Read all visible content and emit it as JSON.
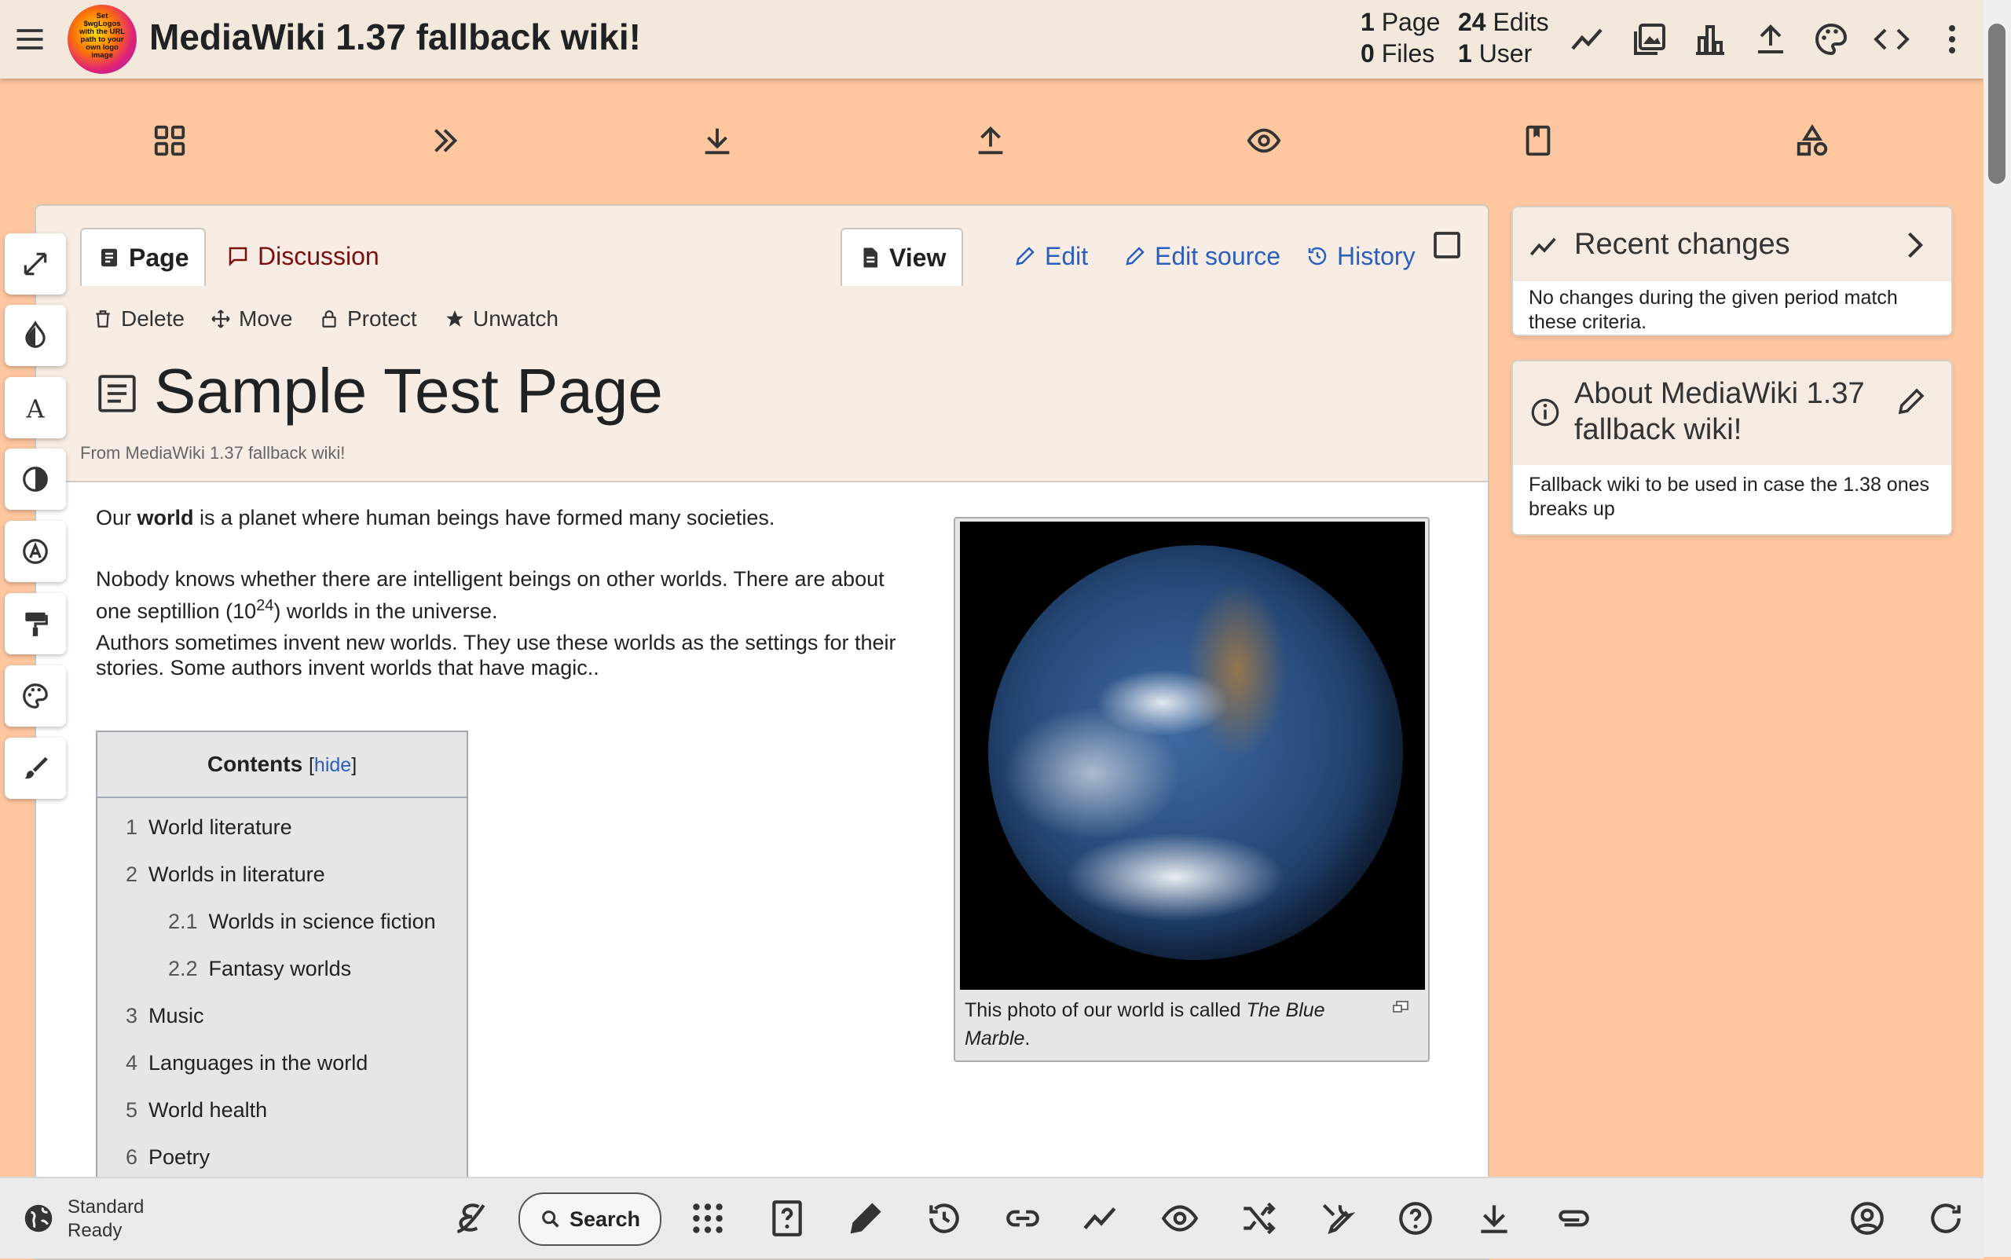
{
  "header": {
    "logo_text": "Set $wgLogos with the URL path to your own logo image",
    "title": "MediaWiki 1.37 fallback wiki!",
    "stats": {
      "pages_count": "1",
      "pages_label": "Page",
      "files_count": "0",
      "files_label": "Files",
      "edits_count": "24",
      "edits_label": "Edits",
      "users_count": "1",
      "users_label": "User"
    },
    "icons": [
      "recent-changes-icon",
      "media-icon",
      "special-pages-icon",
      "upload-icon",
      "theme-icon",
      "code-icon",
      "more-menu-icon"
    ]
  },
  "toolbar": {
    "icons": [
      "grid-icon",
      "double-chevron-icon",
      "download-icon",
      "upload-icon",
      "eye-icon",
      "bookmark-icon",
      "shapes-icon"
    ]
  },
  "tabs": {
    "page": "Page",
    "discussion": "Discussion",
    "view": "View",
    "edit": "Edit",
    "edit_source": "Edit source",
    "history": "History"
  },
  "actions": {
    "delete": "Delete",
    "move": "Move",
    "protect": "Protect",
    "unwatch": "Unwatch"
  },
  "page": {
    "title": "Sample Test Page",
    "from": "From MediaWiki 1.37 fallback wiki!"
  },
  "content": {
    "p1_before": "Our ",
    "p1_bold": "world",
    "p1_after": " is a planet where human beings have formed many societies.",
    "p2_line1": "Nobody knows whether there are intelligent beings on other worlds. There are about",
    "p2_line2_a": "one septillion (10",
    "p2_sup": "24",
    "p2_line2_b": ") worlds in the universe.",
    "p3_line1": "Authors sometimes invent new worlds. They use these worlds as the settings for their",
    "p3_line2": "stories. Some authors invent worlds that have magic.."
  },
  "thumbnail": {
    "caption_a": "This photo of our world is called ",
    "caption_italic1": "The Blue",
    "caption_italic2": "Marble",
    "caption_end": "."
  },
  "toc": {
    "title": "Contents",
    "hide_open": "[",
    "hide": "hide",
    "hide_close": "]",
    "items": [
      {
        "num": "1",
        "label": "World literature"
      },
      {
        "num": "2",
        "label": "Worlds in literature"
      },
      {
        "num": "2.1",
        "label": "Worlds in science fiction"
      },
      {
        "num": "2.2",
        "label": "Fantasy worlds"
      },
      {
        "num": "3",
        "label": "Music"
      },
      {
        "num": "4",
        "label": "Languages in the world"
      },
      {
        "num": "5",
        "label": "World health"
      },
      {
        "num": "6",
        "label": "Poetry"
      }
    ]
  },
  "left_tools": [
    "expand-icon",
    "drop-icon",
    "font-icon",
    "contrast-icon",
    "accessibility-icon",
    "paint-roller-icon",
    "palette-icon",
    "brush-icon"
  ],
  "sidebar": {
    "recent": {
      "title": "Recent changes",
      "body": "No changes during the given period match these criteria."
    },
    "about": {
      "title_line1": "About MediaWiki 1.37",
      "title_line2": "fallback wiki!",
      "body": "Fallback wiki to be used in case the 1.38 ones breaks up"
    }
  },
  "bottom": {
    "skin_label": "Standard",
    "skin_status": "Ready",
    "search": "Search",
    "icons": [
      "edit-icon-e",
      "apps-icon",
      "help-box-icon",
      "pencil-icon",
      "history-icon",
      "link-icon",
      "recent-changes-icon",
      "eye-icon",
      "random-icon",
      "tools-icon",
      "help-icon",
      "download-icon",
      "attachment-icon",
      "account-icon",
      "reload-icon"
    ]
  },
  "colors": {
    "background": "#ffc7a0",
    "header": "#f2e8dc",
    "link": "#2a5fbf",
    "discussion": "#7a0f0f"
  }
}
